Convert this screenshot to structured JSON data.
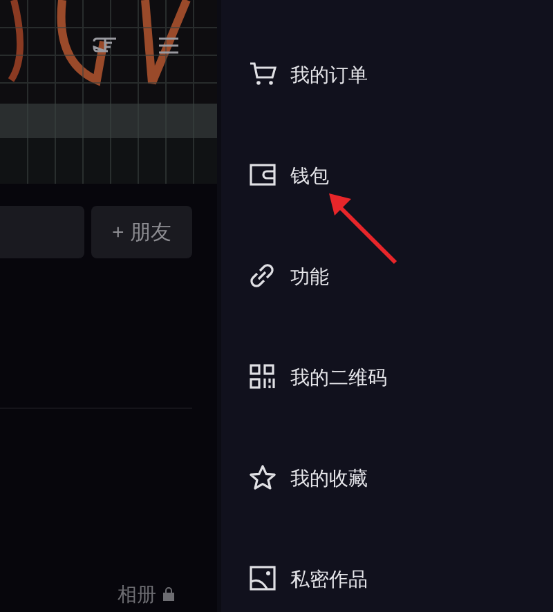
{
  "profile": {
    "add_friend_button": "+ 朋友",
    "tabs": [
      {
        "label": "相册",
        "locked": true
      }
    ]
  },
  "drawer": {
    "items": [
      {
        "label": "我的订单"
      },
      {
        "label": "钱包"
      },
      {
        "label": "功能"
      },
      {
        "label": "我的二维码"
      },
      {
        "label": "我的收藏"
      },
      {
        "label": "私密作品"
      }
    ]
  }
}
